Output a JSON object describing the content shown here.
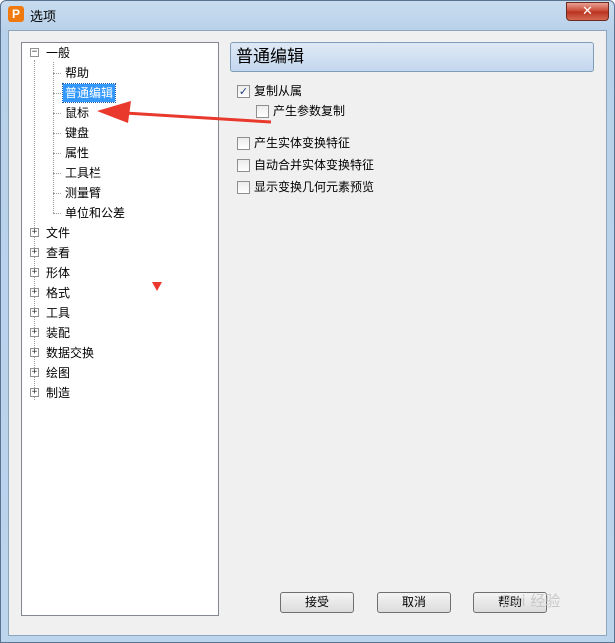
{
  "window": {
    "title": "选项",
    "app_icon_letter": "P",
    "close_symbol": "✕"
  },
  "tree": {
    "root": {
      "label": "一般",
      "expander": "⊟"
    },
    "children": [
      {
        "label": "帮助"
      },
      {
        "label": "普通编辑",
        "selected": true
      },
      {
        "label": "鼠标"
      },
      {
        "label": "键盘"
      },
      {
        "label": "属性"
      },
      {
        "label": "工具栏"
      },
      {
        "label": "测量臂"
      },
      {
        "label": "单位和公差"
      }
    ],
    "collapsed_groups": [
      {
        "label": "文件"
      },
      {
        "label": "查看"
      },
      {
        "label": "形体"
      },
      {
        "label": "格式"
      },
      {
        "label": "工具"
      },
      {
        "label": "装配"
      },
      {
        "label": "数据交换"
      },
      {
        "label": "绘图"
      },
      {
        "label": "制造"
      }
    ],
    "plus": "+",
    "minus": "−"
  },
  "panel": {
    "header": "普通编辑",
    "options": [
      {
        "label": "复制从属",
        "checked": true,
        "indent": 0
      },
      {
        "label": "产生参数复制",
        "checked": false,
        "indent": 1
      },
      {
        "label": "产生实体变换特征",
        "checked": false,
        "indent": 0
      },
      {
        "label": "自动合并实体变换特征",
        "checked": false,
        "indent": 0
      },
      {
        "label": "显示变换几何元素预览",
        "checked": false,
        "indent": 0
      }
    ],
    "check_mark": "✓"
  },
  "buttons": {
    "accept": "接受",
    "cancel": "取消",
    "help": "帮助"
  },
  "annotation": {
    "color": "#e8392c"
  },
  "watermark": "Bai 经验"
}
